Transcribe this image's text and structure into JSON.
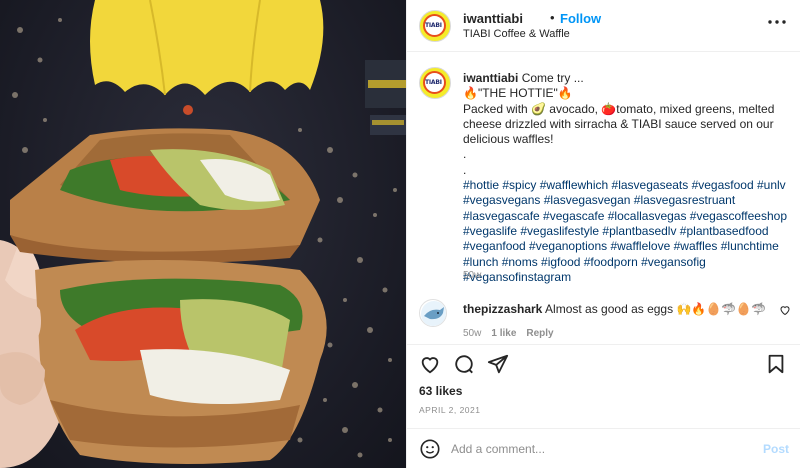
{
  "post": {
    "username": "iwanttiabi",
    "separator": "•",
    "follow_label": "Follow",
    "location": "TIABI Coffee & Waffle",
    "more_label": "•••",
    "avatar_logo": "TIABI"
  },
  "caption": {
    "username": "iwanttiabi",
    "line1": "Come try ...",
    "line2": "🔥\"THE HOTTIE\"🔥",
    "line3": "Packed with 🥑 avocado, 🍅tomato, mixed greens, melted cheese drizzled with sirracha & TIABI sauce served on our delicious waffles!",
    "dot1": ".",
    "dot2": ".",
    "hashtags": "#hottie #spicy #wafflewhich #lasvegaseats #vegasfood #unlv #vegasvegans #lasvegasvegan #lasvegasrestruant #lasvegascafe #vegascafe #locallasvegas #vegascoffeeshop #vegaslife #vegaslifestyle #plantbasedlv #plantbasedfood #veganfood #veganoptions #wafflelove #waffles #lunchtime #lunch #noms #igfood #foodporn #vegansofig #vegansofinstagram",
    "time": "50w"
  },
  "comment": {
    "username": "thepizzashark",
    "text": "Almost as good as eggs 🙌🔥🥚🦈🥚🦈",
    "time": "50w",
    "likes": "1 like",
    "reply": "Reply"
  },
  "actions": {
    "icons": [
      "heart-icon",
      "comment-icon",
      "share-icon",
      "bookmark-icon"
    ]
  },
  "likes": "63 likes",
  "date": "APRIL 2, 2021",
  "add_comment": {
    "placeholder": "Add a comment...",
    "post_label": "Post"
  },
  "colors": {
    "accent": "#0095f6",
    "hashtag": "#00376b",
    "post_disabled": "#b3dbff",
    "meta": "#8e8e8e"
  }
}
